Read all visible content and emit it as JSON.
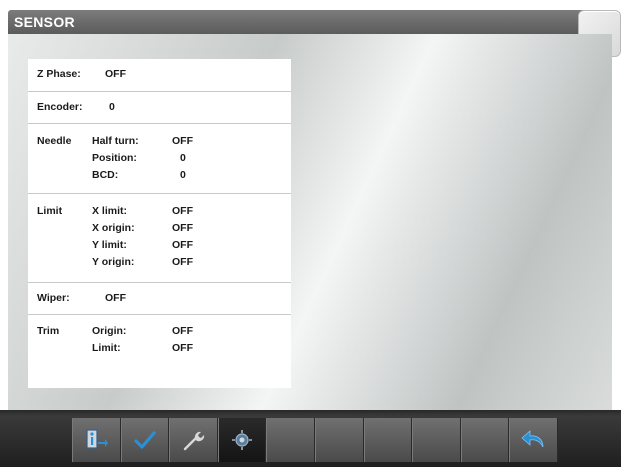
{
  "window": {
    "title": "SENSOR"
  },
  "sensor": {
    "z_phase": {
      "label": "Z Phase:",
      "value": "OFF"
    },
    "encoder": {
      "label": "Encoder:",
      "value": "0"
    },
    "needle": {
      "label": "Needle",
      "items": [
        {
          "label": "Half turn:",
          "value": "OFF"
        },
        {
          "label": "Position:",
          "value": "0"
        },
        {
          "label": "BCD:",
          "value": "0"
        }
      ]
    },
    "limit": {
      "label": "Limit",
      "items": [
        {
          "label": "X limit:",
          "value": "OFF"
        },
        {
          "label": "X origin:",
          "value": "OFF"
        },
        {
          "label": "Y limit:",
          "value": "OFF"
        },
        {
          "label": "Y origin:",
          "value": "OFF"
        }
      ]
    },
    "wiper": {
      "label": "Wiper:",
      "value": "OFF"
    },
    "trim": {
      "label": "Trim",
      "items": [
        {
          "label": "Origin:",
          "value": "OFF"
        },
        {
          "label": "Limit:",
          "value": "OFF"
        }
      ]
    }
  },
  "toolbar": {
    "buttons": [
      {
        "icon": "info-exit-icon"
      },
      {
        "icon": "checkmark-icon"
      },
      {
        "icon": "wrench-icon"
      },
      {
        "icon": "sensor-icon",
        "active": true
      },
      {
        "icon": "empty"
      },
      {
        "icon": "empty"
      },
      {
        "icon": "empty"
      },
      {
        "icon": "empty"
      },
      {
        "icon": "empty"
      },
      {
        "icon": "back-arrow-icon"
      }
    ]
  },
  "colors": {
    "accent_blue": "#2b8fd6",
    "title_bar": "#6a6a6a",
    "toolbar": "#4a4a4a"
  }
}
